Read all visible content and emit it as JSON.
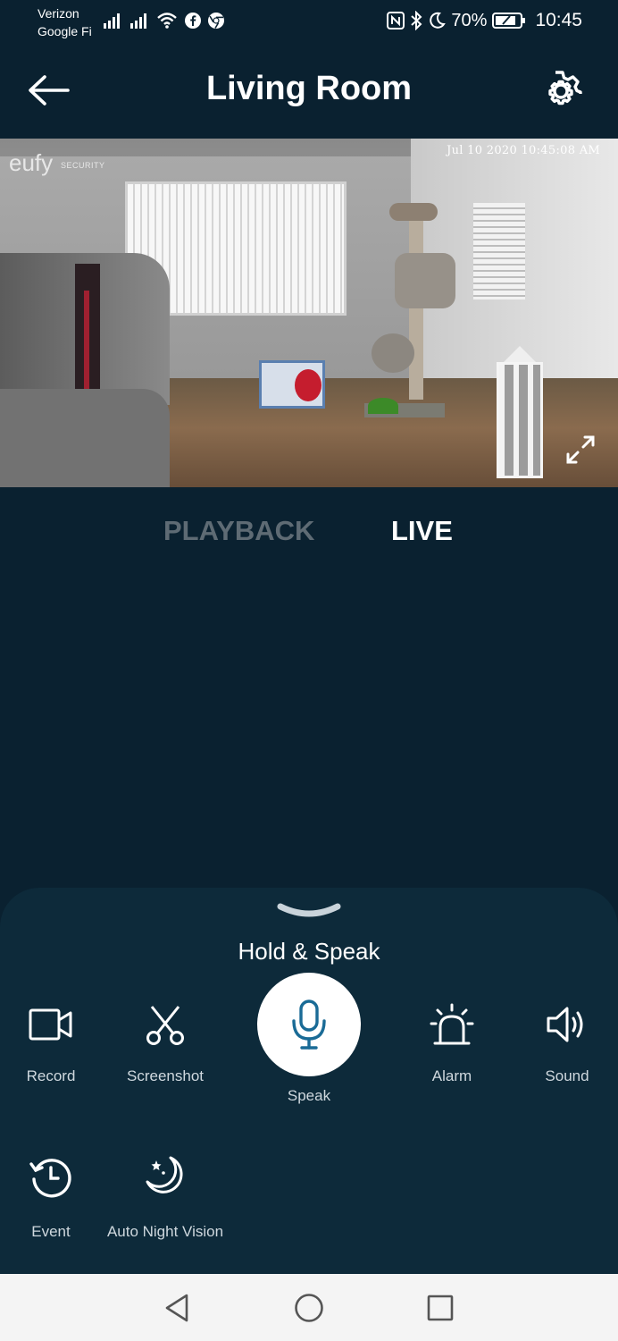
{
  "status_bar": {
    "carrier_line1": "Verizon",
    "carrier_line2": "Google Fi",
    "battery": "70%",
    "time": "10:45"
  },
  "header": {
    "title": "Living Room"
  },
  "video": {
    "logo": "eufy",
    "logo_sub": "SECURITY",
    "timestamp": "Jul 10 2020  10:45:08 AM"
  },
  "tabs": [
    {
      "label": "PLAYBACK",
      "active": false
    },
    {
      "label": "LIVE",
      "active": true
    }
  ],
  "controls": {
    "hold_speak": "Hold & Speak",
    "record": "Record",
    "screenshot": "Screenshot",
    "speak": "Speak",
    "alarm": "Alarm",
    "sound": "Sound",
    "event": "Event",
    "night_vision": "Auto Night Vision"
  },
  "colors": {
    "background": "#0a2130",
    "sheet": "#0d2a3a",
    "accent": "#1a6b96",
    "inactive_tab": "#5e6b74"
  }
}
